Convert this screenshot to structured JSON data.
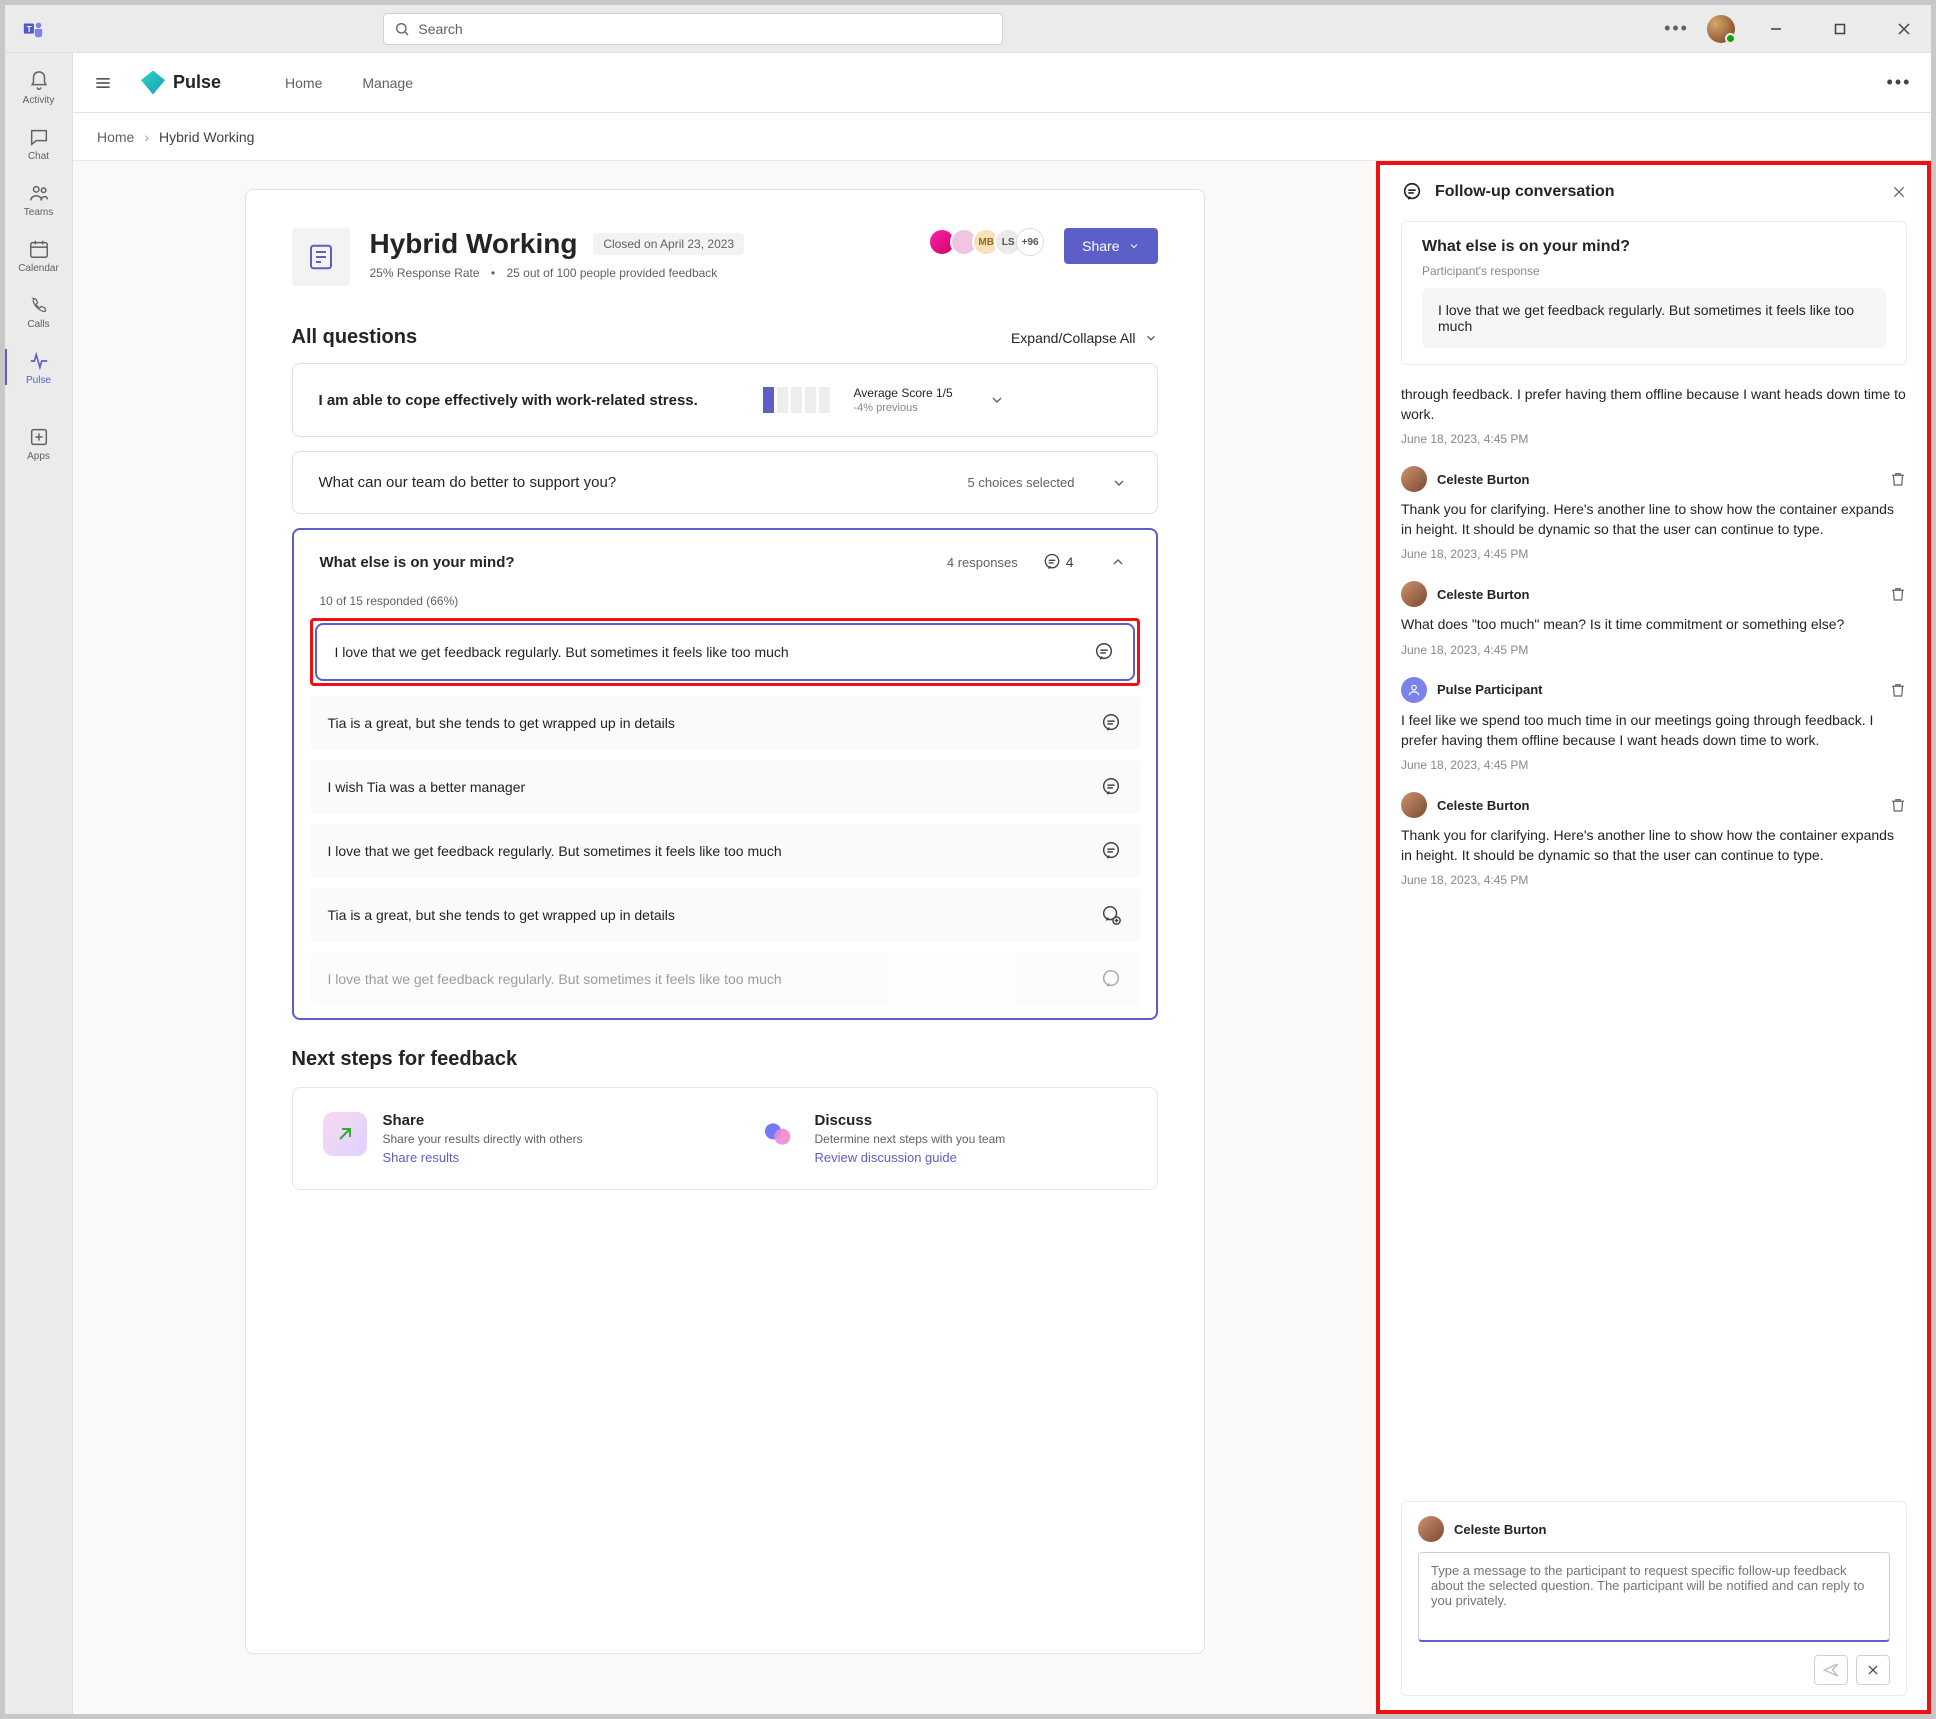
{
  "search": {
    "placeholder": "Search"
  },
  "rail": {
    "items": [
      {
        "label": "Activity"
      },
      {
        "label": "Chat"
      },
      {
        "label": "Teams"
      },
      {
        "label": "Calendar"
      },
      {
        "label": "Calls"
      },
      {
        "label": "Pulse"
      },
      {
        "label": "Apps"
      }
    ]
  },
  "app": {
    "brand": "Pulse",
    "tabs": {
      "home": "Home",
      "manage": "Manage"
    }
  },
  "breadcrumb": {
    "a": "Home",
    "b": "Hybrid Working"
  },
  "survey": {
    "title": "Hybrid Working",
    "status": "Closed on April 23, 2023",
    "response_rate": "25% Response Rate",
    "response_count": "25 out of 100 people provided feedback",
    "share": "Share",
    "face_more": "+96",
    "face_ls": "LS",
    "face_mb": "MB"
  },
  "sections": {
    "all_q": "All questions",
    "expand": "Expand/Collapse All"
  },
  "q1": {
    "text": "I am able to cope effectively with work-related stress.",
    "avg": "Average Score 1/5",
    "delta": "-4% previous"
  },
  "q2": {
    "text": "What can our team do better to support you?",
    "right": "5 choices selected"
  },
  "q3": {
    "text": "What else is on your mind?",
    "responses": "4 responses",
    "comments": "4",
    "meta": "10 of 15 responded (66%)"
  },
  "responses": {
    "r0": "I love that we get feedback regularly. But sometimes it feels like too much",
    "r1": "Tia is a great, but she tends to get wrapped up in details",
    "r2": "I wish Tia was a better manager",
    "r3": "I love that we get feedback regularly. But sometimes it feels like too much",
    "r4": "Tia is a great, but she tends to get wrapped up in details",
    "r5": "I love that we get feedback regularly. But sometimes it feels like too much"
  },
  "next": {
    "heading": "Next steps for feedback",
    "share": {
      "title": "Share",
      "sub": "Share your results directly with others",
      "link": "Share results"
    },
    "discuss": {
      "title": "Discuss",
      "sub": "Determine next steps with you team",
      "link": "Review discussion guide"
    }
  },
  "followup": {
    "title": "Follow-up conversation",
    "box_title": "What else is on your mind?",
    "box_label": "Participant's response",
    "box_quote": "I love that we get feedback regularly. But sometimes it feels like too much",
    "m0": {
      "body": "through feedback. I prefer having them offline because I want heads down time to work.",
      "time": "June 18, 2023, 4:45 PM"
    },
    "m1": {
      "name": "Celeste Burton",
      "body": "Thank you for clarifying. Here's another line to show how the container expands in height. It should be dynamic so that the user can continue to type.",
      "time": "June 18, 2023, 4:45 PM"
    },
    "m2": {
      "name": "Celeste Burton",
      "body": "What does \"too much\" mean? Is it time commitment or something else?",
      "time": "June 18, 2023, 4:45 PM"
    },
    "m3": {
      "name": "Pulse Participant",
      "body": "I feel like we spend too much time in our meetings going through feedback. I prefer having them offline because I want heads down time to work.",
      "time": "June 18, 2023, 4:45 PM"
    },
    "m4": {
      "name": "Celeste Burton",
      "body": "Thank you for clarifying. Here's another line to show how the container expands in height. It should be dynamic so that the user can continue to type.",
      "time": "June 18, 2023, 4:45 PM"
    },
    "compose": {
      "name": "Celeste Burton",
      "placeholder": "Type a message to the participant to request specific follow-up feedback about the selected question. The participant will be notified and can reply to you privately."
    }
  }
}
